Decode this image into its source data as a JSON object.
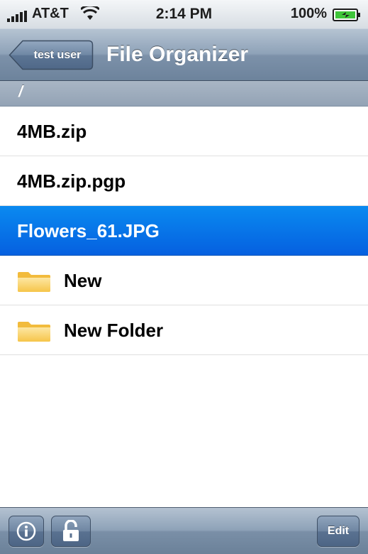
{
  "status_bar": {
    "carrier": "AT&T",
    "time": "2:14 PM",
    "battery": "100%"
  },
  "nav": {
    "back_label": "test user",
    "title": "File Organizer"
  },
  "path": "/",
  "files": [
    {
      "name": "4MB.zip",
      "type": "file",
      "selected": false
    },
    {
      "name": "4MB.zip.pgp",
      "type": "file",
      "selected": false
    },
    {
      "name": "Flowers_61.JPG",
      "type": "file",
      "selected": true
    },
    {
      "name": "New",
      "type": "folder",
      "selected": false
    },
    {
      "name": "New Folder",
      "type": "folder",
      "selected": false
    }
  ],
  "toolbar": {
    "info_icon": "info-icon",
    "lock_icon": "unlocked-padlock-icon",
    "edit_label": "Edit"
  },
  "colors": {
    "selection": "#0a74ea",
    "navbar": "#8ea2b8"
  }
}
